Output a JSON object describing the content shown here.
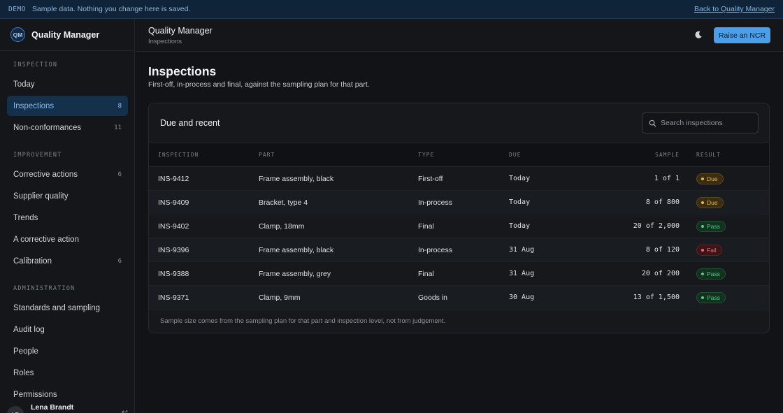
{
  "banner": {
    "tag": "DEMO",
    "message": "Sample data. Nothing you change here is saved.",
    "back_link": "Back to Quality Manager"
  },
  "app": {
    "logo_initials": "QM",
    "name": "Quality Manager"
  },
  "sidebar": {
    "sections": [
      {
        "title": "INSPECTION",
        "items": [
          {
            "label": "Today",
            "count": ""
          },
          {
            "label": "Inspections",
            "count": "8",
            "active": true
          },
          {
            "label": "Non-conformances",
            "count": "11"
          }
        ]
      },
      {
        "title": "IMPROVEMENT",
        "items": [
          {
            "label": "Corrective actions",
            "count": "6"
          },
          {
            "label": "Supplier quality",
            "count": ""
          },
          {
            "label": "Trends",
            "count": ""
          },
          {
            "label": "A corrective action",
            "count": ""
          },
          {
            "label": "Calibration",
            "count": "6"
          }
        ]
      },
      {
        "title": "ADMINISTRATION",
        "items": [
          {
            "label": "Standards and sampling",
            "count": ""
          },
          {
            "label": "Audit log",
            "count": ""
          },
          {
            "label": "People",
            "count": ""
          },
          {
            "label": "Roles",
            "count": ""
          },
          {
            "label": "Permissions",
            "count": ""
          }
        ]
      }
    ],
    "user": {
      "initials": "LB",
      "name": "Lena Brandt"
    }
  },
  "header": {
    "title": "Quality Manager",
    "breadcrumb": "Inspections",
    "theme_icon": "moon-icon",
    "cta_label": "Raise an NCR"
  },
  "page": {
    "title": "Inspections",
    "subtitle": "First-off, in-process and final, against the sampling plan for that part."
  },
  "card": {
    "title": "Due and recent",
    "search_placeholder": "Search inspections",
    "columns": [
      "INSPECTION",
      "PART",
      "TYPE",
      "DUE",
      "SAMPLE",
      "RESULT"
    ],
    "rows": [
      {
        "id": "INS-9412",
        "part": "Frame assembly, black",
        "type": "First-off",
        "due": "Today",
        "sample": "1 of 1",
        "result": "Due",
        "status": "due"
      },
      {
        "id": "INS-9409",
        "part": "Bracket, type 4",
        "type": "In-process",
        "due": "Today",
        "sample": "8 of 800",
        "result": "Due",
        "status": "due"
      },
      {
        "id": "INS-9402",
        "part": "Clamp, 18mm",
        "type": "Final",
        "due": "Today",
        "sample": "20 of 2,000",
        "result": "Pass",
        "status": "pass"
      },
      {
        "id": "INS-9396",
        "part": "Frame assembly, black",
        "type": "In-process",
        "due": "31 Aug",
        "sample": "8 of 120",
        "result": "Fail",
        "status": "fail"
      },
      {
        "id": "INS-9388",
        "part": "Frame assembly, grey",
        "type": "Final",
        "due": "31 Aug",
        "sample": "20 of 200",
        "result": "Pass",
        "status": "pass"
      },
      {
        "id": "INS-9371",
        "part": "Clamp, 9mm",
        "type": "Goods in",
        "due": "30 Aug",
        "sample": "13 of 1,500",
        "result": "Pass",
        "status": "pass"
      }
    ],
    "footnote": "Sample size comes from the sampling plan for that part and inspection level, not from judgement."
  },
  "colors": {
    "accent": "#4a9fe8",
    "due": "#e3b659",
    "pass": "#56c98a",
    "fail": "#ec6d6d"
  }
}
